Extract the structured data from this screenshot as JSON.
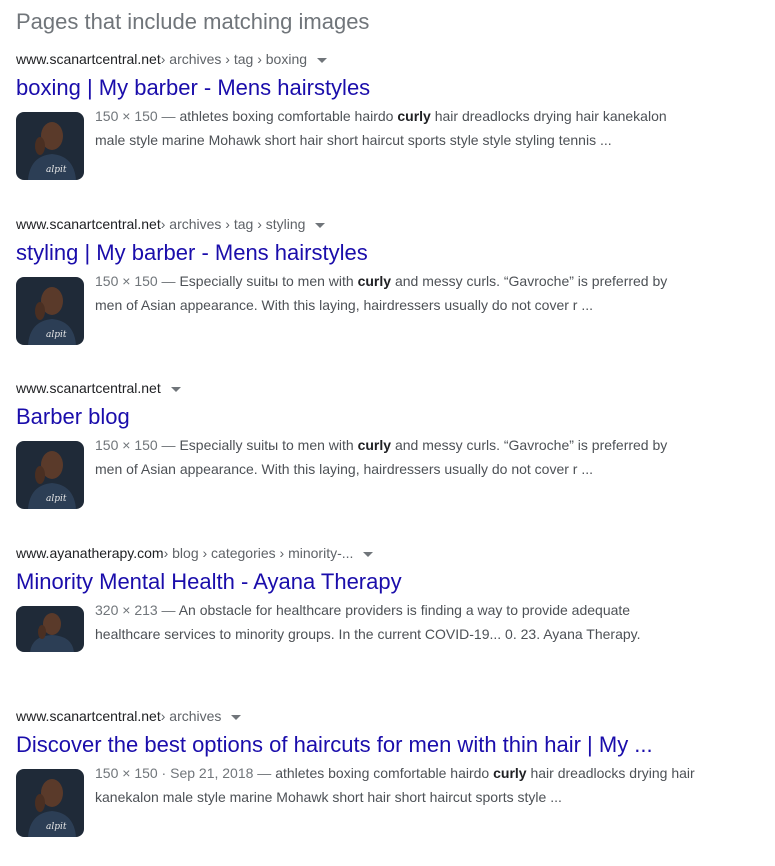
{
  "heading": "Pages that include matching images",
  "results": [
    {
      "domain": "www.scanartcentral.net",
      "crumbs": " › archives › tag › boxing",
      "title": "boxing | My barber - Mens hairstyles",
      "meta": "150 × 150 — ",
      "pre": "athletes boxing comfortable hairdo ",
      "bold": "curly",
      "post": " hair dreadlocks drying hair kanekalon male style marine Mohawk short hair short haircut sports style style styling tennis ..."
    },
    {
      "domain": "www.scanartcentral.net",
      "crumbs": " › archives › tag › styling",
      "title": "styling | My barber - Mens hairstyles",
      "meta": "150 × 150 — ",
      "pre": "Especially suitы to men with ",
      "bold": "curly",
      "post": " and messy curls. “Gavroche” is preferred by men of Asian appearance. With this laying, hairdressers usually do not cover r ..."
    },
    {
      "domain": "www.scanartcentral.net",
      "crumbs": "",
      "title": "Barber blog",
      "meta": "150 × 150 — ",
      "pre": "Especially suitы to men with ",
      "bold": "curly",
      "post": " and messy curls. “Gavroche” is preferred by men of Asian appearance. With this laying, hairdressers usually do not cover r ..."
    },
    {
      "domain": "www.ayanatherapy.com",
      "crumbs": " › blog › categories › minority-...",
      "title": "Minority Mental Health - Ayana Therapy",
      "meta": "320 × 213 — ",
      "pre": "An obstacle for healthcare providers is finding a way to provide adequate healthcare services to minority groups. In the current COVID-19... 0. 23. Ayana Therapy.",
      "bold": "",
      "post": ""
    },
    {
      "domain": "www.scanartcentral.net",
      "crumbs": " › archives",
      "title": "Discover the best options of haircuts for men with thin hair | My ...",
      "meta": "150 × 150 · Sep 21, 2018 — ",
      "pre": "athletes boxing comfortable hairdo ",
      "bold": "curly",
      "post": " hair dreadlocks drying hair kanekalon male style marine Mohawk short hair short haircut sports style ..."
    }
  ],
  "colors": {
    "link": "#1a0dab",
    "cite": "#202124",
    "snippet": "#4d5156",
    "meta": "#70757a",
    "heading": "#70757a"
  },
  "icons": [
    "dropdown-caret-icon",
    "thumbnail-image"
  ]
}
